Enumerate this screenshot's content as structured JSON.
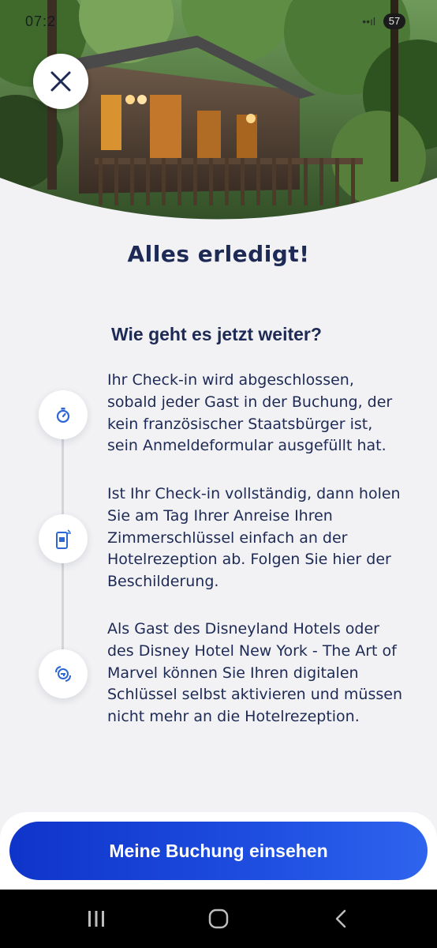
{
  "status_bar": {
    "time": "07:2",
    "battery": "57",
    "signal": "••ıl"
  },
  "header": {
    "close_icon": "close-icon"
  },
  "main": {
    "title": "Alles erledigt!",
    "subtitle": "Wie geht es jetzt weiter?",
    "steps": [
      {
        "icon": "stopwatch-icon",
        "text": "Ihr Check-in wird abgeschlossen, sobald jeder Gast in der Buchung, der kein französischer Staatsbürger ist, sein Anmeldeformular ausgefüllt hat."
      },
      {
        "icon": "mobile-key-icon",
        "text": "Ist Ihr Check-in vollständig, dann holen Sie am Tag Ihrer Anreise Ihren Zimmerschlüssel einfach an der Hotelrezeption ab. Folgen Sie hier der Beschilderung."
      },
      {
        "icon": "digital-key-icon",
        "text": "Als Gast des Disneyland Hotels oder des Disney Hotel New York - The Art of Marvel können Sie Ihren digitalen Schlüssel selbst aktivieren und müssen nicht mehr an die Hotelrezeption."
      }
    ]
  },
  "footer": {
    "primary_button": "Meine Buchung einsehen"
  },
  "navbar": {
    "recent_icon": "recent-apps-icon",
    "home_icon": "home-icon",
    "back_icon": "back-icon"
  },
  "colors": {
    "accent": "#1e4ee0",
    "title": "#1d2a55",
    "icon_blue": "#2f66d6",
    "background": "#f2f2f4"
  }
}
